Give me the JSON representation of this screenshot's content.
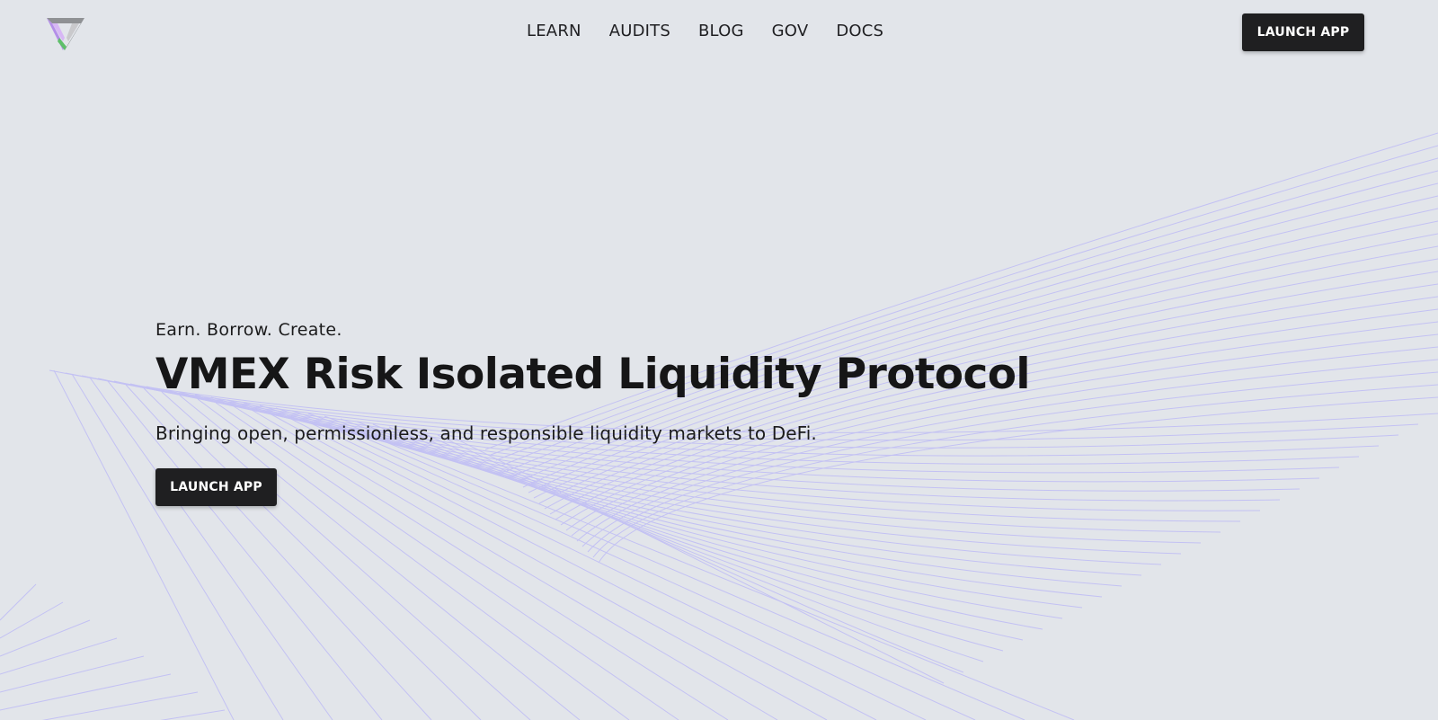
{
  "brand": {
    "logo_icon": "vmex-triangle-logo-icon",
    "colors": {
      "background": "#e2e5ea",
      "button_bg": "#1f1f21",
      "button_text": "#ffffff",
      "text": "#1b1b1c",
      "lines": "#b9b6f7",
      "logo_purple": "#b48ee8",
      "logo_green": "#5fbf6a",
      "logo_grey": "#8f9194"
    }
  },
  "nav": {
    "items": [
      {
        "label": "LEARN"
      },
      {
        "label": "AUDITS"
      },
      {
        "label": "BLOG"
      },
      {
        "label": "GOV"
      },
      {
        "label": "DOCS"
      }
    ]
  },
  "header": {
    "launch_label": "LAUNCH APP"
  },
  "hero": {
    "eyebrow": "Earn. Borrow. Create.",
    "title": "VMEX Risk Isolated Liquidity Protocol",
    "subtitle": "Bringing open, permissionless, and responsible liquidity markets to DeFi.",
    "launch_label": "LAUNCH APP"
  }
}
